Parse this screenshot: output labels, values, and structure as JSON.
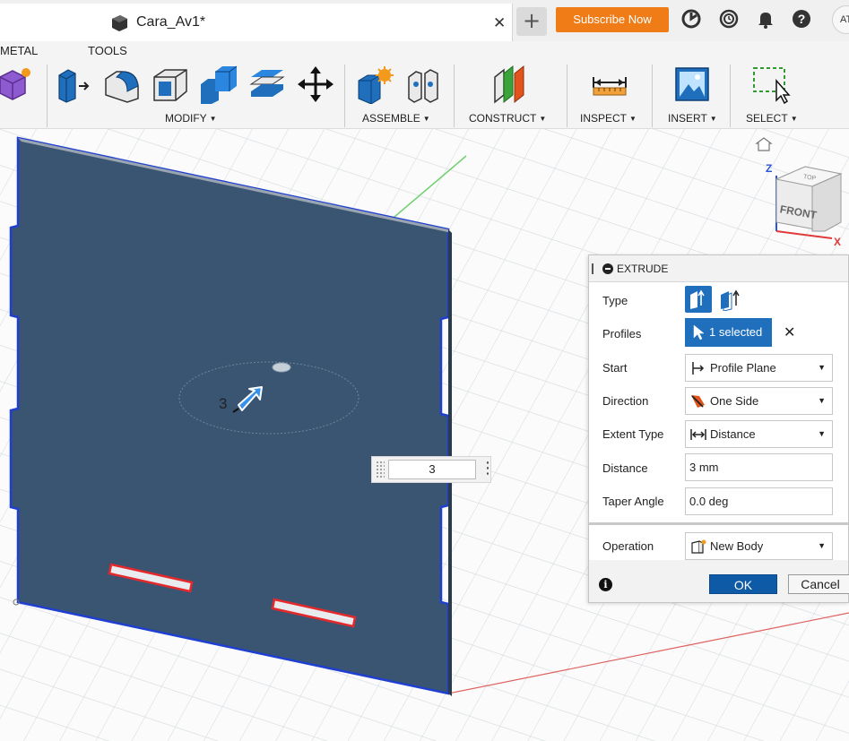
{
  "tabbar": {
    "doc_title": "Cara_Av1*",
    "close_glyph": "✕",
    "new_tab_glyph": "+",
    "subscribe_label": "Subscribe Now",
    "icons": [
      "job-status-icon",
      "history-clock-icon",
      "notifications-bell-icon",
      "help-icon"
    ],
    "avatar_initials": "AT"
  },
  "toolbar": {
    "workspace_tabs": [
      "METAL",
      "TOOLS"
    ],
    "groups": {
      "modify": "MODIFY",
      "assemble": "ASSEMBLE",
      "construct": "CONSTRUCT",
      "inspect": "INSPECT",
      "insert": "INSERT",
      "select": "SELECT"
    },
    "dropdown_glyph": "▼"
  },
  "viewport": {
    "dim_label": "3",
    "distance_input": "3",
    "more_glyph": "⋮",
    "viewcube": {
      "face": "FRONT",
      "top": "TOP",
      "axis_z": "Z",
      "axis_x": "X"
    },
    "colors": {
      "body": "#3a5572",
      "edge": "#1e3fd0",
      "slot": "#e4292c",
      "grid": "#d9dee3"
    }
  },
  "extrude": {
    "title": "EXTRUDE",
    "rows": {
      "type": "Type",
      "profiles": "Profiles",
      "start": "Start",
      "direction": "Direction",
      "extent_type": "Extent Type",
      "distance": "Distance",
      "taper_angle": "Taper Angle",
      "operation": "Operation"
    },
    "profiles_value": "1 selected",
    "clear_glyph": "✕",
    "start_value": "Profile Plane",
    "direction_value": "One Side",
    "extent_value": "Distance",
    "distance_value": "3 mm",
    "taper_value": "0.0 deg",
    "operation_value": "New Body",
    "ok_label": "OK",
    "cancel_label": "Cancel",
    "info_glyph": "i",
    "accent": "#1f6fbd"
  }
}
